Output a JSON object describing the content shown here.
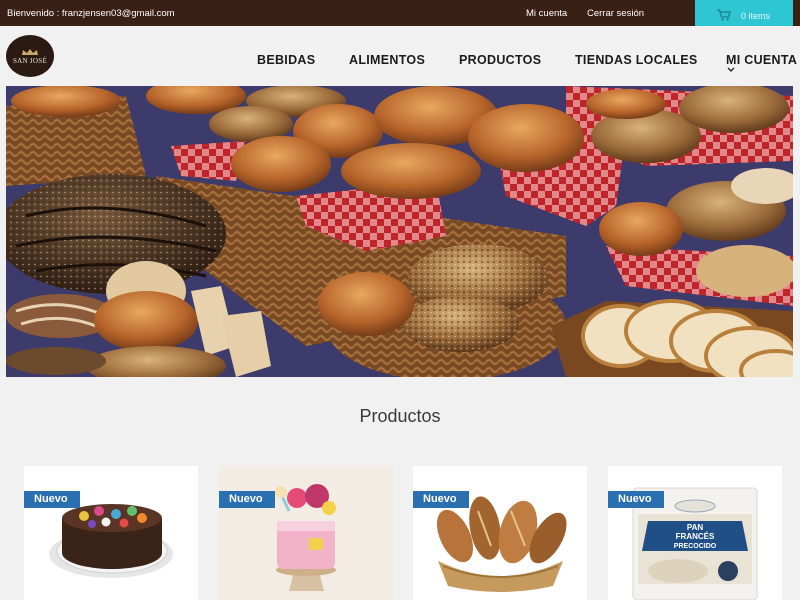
{
  "topbar": {
    "welcome": "Bienvenido : franzjensen03@gmail.com",
    "my_account": "Mi cuenta",
    "logout": "Cerrar sesión",
    "cart_text": "0 items",
    "cart_icon": "shopping-cart-icon"
  },
  "logo": {
    "text": "SAN JOSÉ"
  },
  "nav": {
    "items": [
      "BEBIDAS",
      "ALIMENTOS",
      "PRODUCTOS",
      "TIENDAS LOCALES",
      "MI CUENTA"
    ]
  },
  "section": {
    "title": "Productos"
  },
  "products": [
    {
      "badge": "Nuevo"
    },
    {
      "badge": "Nuevo"
    },
    {
      "badge": "Nuevo"
    },
    {
      "badge": "Nuevo"
    }
  ],
  "package_text": {
    "line1": "PAN",
    "line2": "FRANCÉS",
    "line3": "PRECOCIDO"
  },
  "colors": {
    "topbar": "#3a1f14",
    "cart": "#2ec6d3",
    "badge": "#2a6fb0",
    "background": "#f1f1f1"
  }
}
